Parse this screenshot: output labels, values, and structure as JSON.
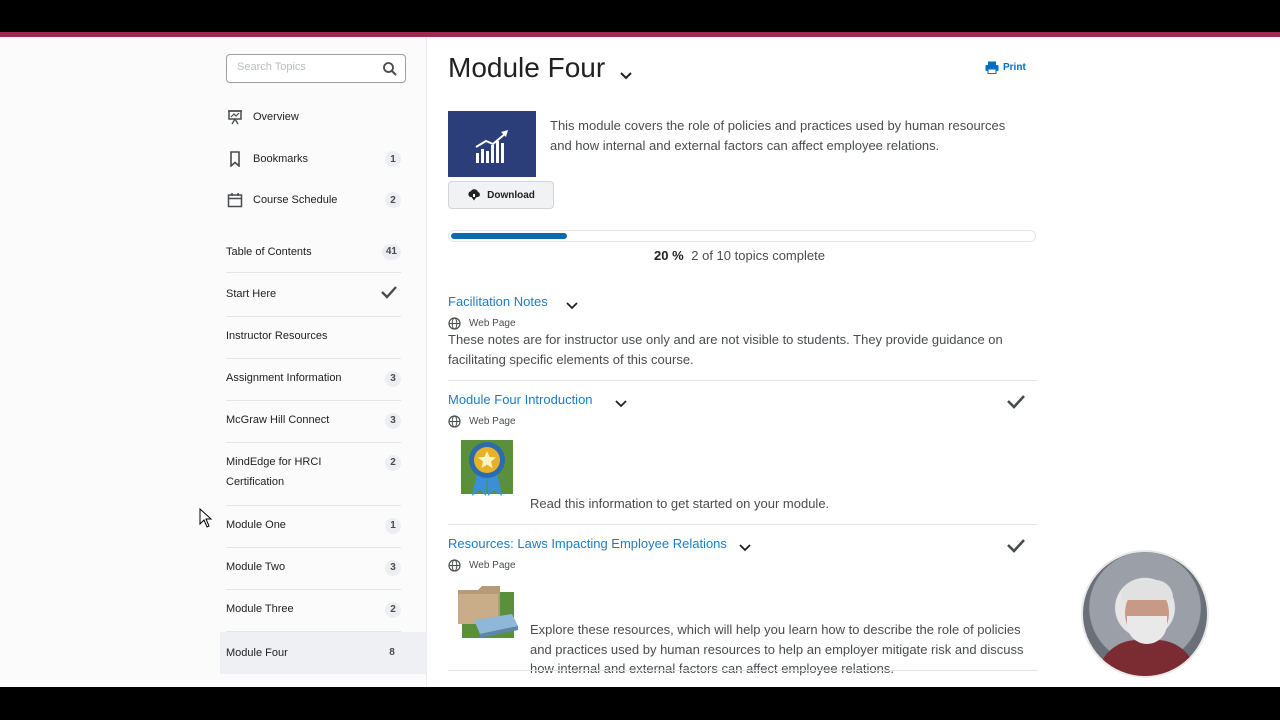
{
  "sidebar": {
    "search_placeholder": "Search Topics",
    "nav": [
      {
        "label": "Overview",
        "icon": "presentation-icon"
      },
      {
        "label": "Bookmarks",
        "icon": "bookmark-icon",
        "count": "1"
      },
      {
        "label": "Course Schedule",
        "icon": "calendar-icon",
        "count": "2"
      }
    ],
    "toc": [
      {
        "label": "Table of Contents",
        "count": "41"
      },
      {
        "label": "Start Here",
        "status": "complete"
      },
      {
        "label": "Instructor Resources"
      },
      {
        "label": "Assignment Information",
        "count": "3"
      },
      {
        "label": "McGraw Hill Connect",
        "count": "3"
      },
      {
        "label": "MindEdge for HRCI Certification",
        "count": "2"
      },
      {
        "label": "Module One",
        "count": "1"
      },
      {
        "label": "Module Two",
        "count": "3"
      },
      {
        "label": "Module Three",
        "count": "2"
      },
      {
        "label": "Module Four",
        "count": "8",
        "selected": true
      }
    ]
  },
  "main": {
    "title": "Module Four",
    "print_label": "Print",
    "description": "This module covers the role of policies and practices used by human resources and how internal and external factors can affect employee relations.",
    "download_label": "Download",
    "progress": {
      "percent": 20,
      "percent_label": "20 %",
      "text": "2 of 10 topics complete"
    },
    "topics": [
      {
        "title": "Facilitation Notes",
        "type": "Web Page",
        "description": "These notes are for instructor use only and are not visible to students. They provide guidance on facilitating specific elements of this course.",
        "complete": false
      },
      {
        "title": "Module Four Introduction",
        "type": "Web Page",
        "description": "Read this information to get started on your module.",
        "complete": true,
        "image": "award-ribbon-icon"
      },
      {
        "title": "Resources: Laws Impacting Employee Relations",
        "type": "Web Page",
        "description": "Explore these resources, which will help you learn how to describe the role of policies and practices used by human resources to help an employer mitigate risk and discuss how internal and external factors can affect employee relations.",
        "complete": true,
        "image": "folder-book-icon"
      }
    ]
  },
  "colors": {
    "accent": "#9c2b4f",
    "link": "#1f7bbf",
    "progress": "#0a6bb3"
  }
}
